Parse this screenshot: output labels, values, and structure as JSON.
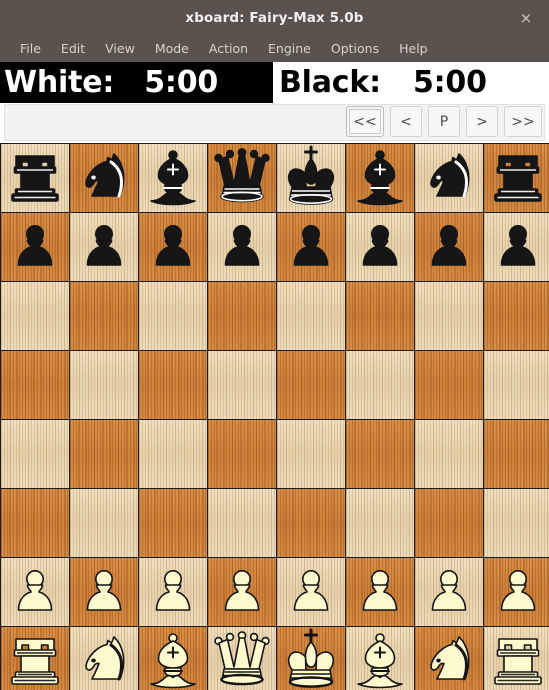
{
  "window": {
    "title": "xboard: Fairy-Max 5.0b",
    "close_label": "×",
    "titlebar_color": "#5a524d"
  },
  "menubar": {
    "items": [
      {
        "label": "File"
      },
      {
        "label": "Edit"
      },
      {
        "label": "View"
      },
      {
        "label": "Mode"
      },
      {
        "label": "Action"
      },
      {
        "label": "Engine"
      },
      {
        "label": "Options"
      },
      {
        "label": "Help"
      }
    ]
  },
  "clocks": {
    "white": {
      "label": "White:",
      "time": "5:00",
      "active": true
    },
    "black": {
      "label": "Black:",
      "time": "5:00",
      "active": false
    }
  },
  "toolbar": {
    "buttons": [
      {
        "label": "<<",
        "name": "first-move-button",
        "focused": true
      },
      {
        "label": "<",
        "name": "previous-move-button",
        "focused": false
      },
      {
        "label": "P",
        "name": "pause-button",
        "focused": false
      },
      {
        "label": ">",
        "name": "next-move-button",
        "focused": false
      },
      {
        "label": ">>",
        "name": "last-move-button",
        "focused": false
      }
    ]
  },
  "board": {
    "colors": {
      "light_square": "#ead9b6",
      "dark_square": "#d2883f",
      "white_piece": "#fffacd",
      "black_piece": "#161616",
      "grid_line": "#1a1a1a"
    },
    "rows": [
      [
        "br",
        "bn",
        "bb",
        "bq",
        "bk",
        "bb",
        "bn",
        "br"
      ],
      [
        "bp",
        "bp",
        "bp",
        "bp",
        "bp",
        "bp",
        "bp",
        "bp"
      ],
      [
        "",
        "",
        "",
        "",
        "",
        "",
        "",
        ""
      ],
      [
        "",
        "",
        "",
        "",
        "",
        "",
        "",
        ""
      ],
      [
        "",
        "",
        "",
        "",
        "",
        "",
        "",
        ""
      ],
      [
        "",
        "",
        "",
        "",
        "",
        "",
        "",
        ""
      ],
      [
        "wp",
        "wp",
        "wp",
        "wp",
        "wp",
        "wp",
        "wp",
        "wp"
      ],
      [
        "wr",
        "wn",
        "wb",
        "wq",
        "wk",
        "wb",
        "wn",
        "wr"
      ]
    ],
    "piece_names": {
      "br": "black-rook",
      "bn": "black-knight",
      "bb": "black-bishop",
      "bq": "black-queen",
      "bk": "black-king",
      "bp": "black-pawn",
      "wr": "white-rook",
      "wn": "white-knight",
      "wb": "white-bishop",
      "wq": "white-queen",
      "wk": "white-king",
      "wp": "white-pawn"
    }
  }
}
